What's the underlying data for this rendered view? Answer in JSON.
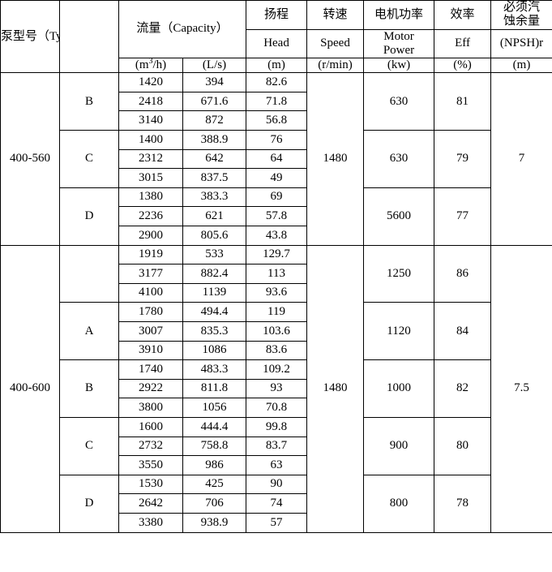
{
  "table": {
    "columns": [
      {
        "key": "type",
        "title_cn": "泵型号（Type）",
        "title_en": "",
        "unit": ""
      },
      {
        "key": "variant",
        "title_cn": "",
        "title_en": "",
        "unit": ""
      },
      {
        "key": "capacity_m3h",
        "group_cn": "流量（Capacity）",
        "unit": "(m3/h)",
        "unit_base": "(m",
        "unit_sup": "3",
        "unit_tail": "/h)"
      },
      {
        "key": "capacity_ls",
        "group_cn": "流量（Capacity）",
        "unit": "(L/s)"
      },
      {
        "key": "head",
        "title_cn": "扬程",
        "title_en": "Head",
        "unit": "(m)"
      },
      {
        "key": "speed",
        "title_cn": "转速",
        "title_en": "Speed",
        "unit": "(r/min)"
      },
      {
        "key": "motor_power",
        "title_cn": "电机功率",
        "title_en_line1": "Motor",
        "title_en_line2": "Power",
        "unit": "(kw)"
      },
      {
        "key": "eff",
        "title_cn": "效率",
        "title_en": "Eff",
        "unit": "(%)"
      },
      {
        "key": "npshr",
        "title_cn_line1": "必须汽",
        "title_cn_line2": "蚀余量",
        "title_en": "(NPSH)r",
        "unit": "(m)"
      }
    ],
    "blocks": [
      {
        "type": "400-560",
        "speed": "1480",
        "npshr": "7",
        "groups": [
          {
            "variant": "B",
            "motor_power": "630",
            "eff": "81",
            "rows": [
              {
                "capacity_m3h": "1420",
                "capacity_ls": "394",
                "head": "82.6"
              },
              {
                "capacity_m3h": "2418",
                "capacity_ls": "671.6",
                "head": "71.8"
              },
              {
                "capacity_m3h": "3140",
                "capacity_ls": "872",
                "head": "56.8"
              }
            ]
          },
          {
            "variant": "C",
            "motor_power": "630",
            "eff": "79",
            "rows": [
              {
                "capacity_m3h": "1400",
                "capacity_ls": "388.9",
                "head": "76"
              },
              {
                "capacity_m3h": "2312",
                "capacity_ls": "642",
                "head": "64"
              },
              {
                "capacity_m3h": "3015",
                "capacity_ls": "837.5",
                "head": "49"
              }
            ]
          },
          {
            "variant": "D",
            "motor_power": "5600",
            "eff": "77",
            "rows": [
              {
                "capacity_m3h": "1380",
                "capacity_ls": "383.3",
                "head": "69"
              },
              {
                "capacity_m3h": "2236",
                "capacity_ls": "621",
                "head": "57.8"
              },
              {
                "capacity_m3h": "2900",
                "capacity_ls": "805.6",
                "head": "43.8"
              }
            ]
          }
        ]
      },
      {
        "type": "400-600",
        "speed": "1480",
        "npshr": "7.5",
        "groups": [
          {
            "variant": "",
            "motor_power": "1250",
            "eff": "86",
            "rows": [
              {
                "capacity_m3h": "1919",
                "capacity_ls": "533",
                "head": "129.7"
              },
              {
                "capacity_m3h": "3177",
                "capacity_ls": "882.4",
                "head": "113"
              },
              {
                "capacity_m3h": "4100",
                "capacity_ls": "1139",
                "head": "93.6"
              }
            ]
          },
          {
            "variant": "A",
            "motor_power": "1120",
            "eff": "84",
            "rows": [
              {
                "capacity_m3h": "1780",
                "capacity_ls": "494.4",
                "head": "119"
              },
              {
                "capacity_m3h": "3007",
                "capacity_ls": "835.3",
                "head": "103.6"
              },
              {
                "capacity_m3h": "3910",
                "capacity_ls": "1086",
                "head": "83.6"
              }
            ]
          },
          {
            "variant": "B",
            "motor_power": "1000",
            "eff": "82",
            "rows": [
              {
                "capacity_m3h": "1740",
                "capacity_ls": "483.3",
                "head": "109.2"
              },
              {
                "capacity_m3h": "2922",
                "capacity_ls": "811.8",
                "head": "93"
              },
              {
                "capacity_m3h": "3800",
                "capacity_ls": "1056",
                "head": "70.8"
              }
            ]
          },
          {
            "variant": "C",
            "motor_power": "900",
            "eff": "80",
            "rows": [
              {
                "capacity_m3h": "1600",
                "capacity_ls": "444.4",
                "head": "99.8"
              },
              {
                "capacity_m3h": "2732",
                "capacity_ls": "758.8",
                "head": "83.7"
              },
              {
                "capacity_m3h": "3550",
                "capacity_ls": "986",
                "head": "63"
              }
            ]
          },
          {
            "variant": "D",
            "motor_power": "800",
            "eff": "78",
            "rows": [
              {
                "capacity_m3h": "1530",
                "capacity_ls": "425",
                "head": "90"
              },
              {
                "capacity_m3h": "2642",
                "capacity_ls": "706",
                "head": "74"
              },
              {
                "capacity_m3h": "3380",
                "capacity_ls": "938.9",
                "head": "57"
              }
            ]
          }
        ]
      }
    ]
  }
}
